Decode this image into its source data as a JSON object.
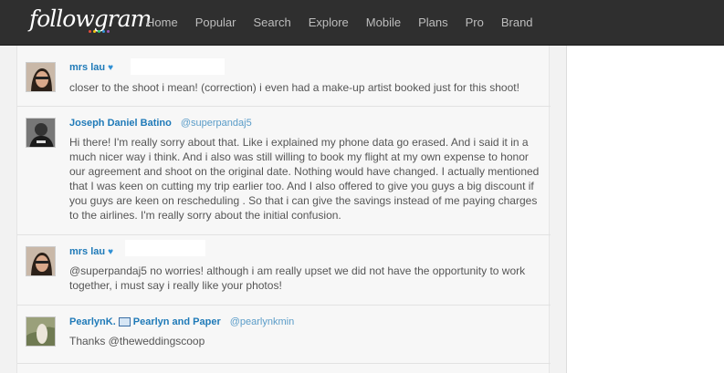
{
  "brand": {
    "logo_text": "followgram",
    "logo_dot_colors": [
      "#e74c3c",
      "#f1c40f",
      "#2ecc71",
      "#3498db",
      "#9b59b6"
    ]
  },
  "nav": {
    "items": [
      "Home",
      "Popular",
      "Search",
      "Explore",
      "Mobile",
      "Plans",
      "Pro",
      "Brand"
    ]
  },
  "comments": [
    {
      "name": "mrs lau",
      "verified_icon": "heart-icon",
      "handle": "",
      "text": "closer to the shoot i mean! (correction) i even had a make-up artist booked just for this shoot!"
    },
    {
      "name": "Joseph Daniel Batino",
      "handle": "@superpandaj5",
      "text": "Hi there! I'm really sorry about that. Like i explained my phone data go erased. And i said it in a much nicer way i think. And i also was still willing to book my flight at my own expense to honor our agreement and shoot on the original date. Nothing would have changed. I actually mentioned that I was keen on cutting my trip earlier too. And I also offered to give you guys a big discount if you guys are keen on rescheduling . So that i can give the savings instead of me paying charges to the airlines. I'm really sorry about the initial confusion."
    },
    {
      "name": "mrs lau",
      "verified_icon": "heart-icon",
      "handle": "",
      "text": "@superpandaj5 no worries! although i am really upset we did not have the opportunity to work together, i must say i really like your photos!"
    },
    {
      "name_prefix": "PearlynK.",
      "name_suffix": "Pearlyn and Paper",
      "handle": "@pearlynkmin",
      "text": "Thanks @theweddingscoop"
    }
  ],
  "colors": {
    "topbar": "#2f2f2f",
    "link": "#1f7ab8",
    "page_bg": "#f2f2f2"
  }
}
